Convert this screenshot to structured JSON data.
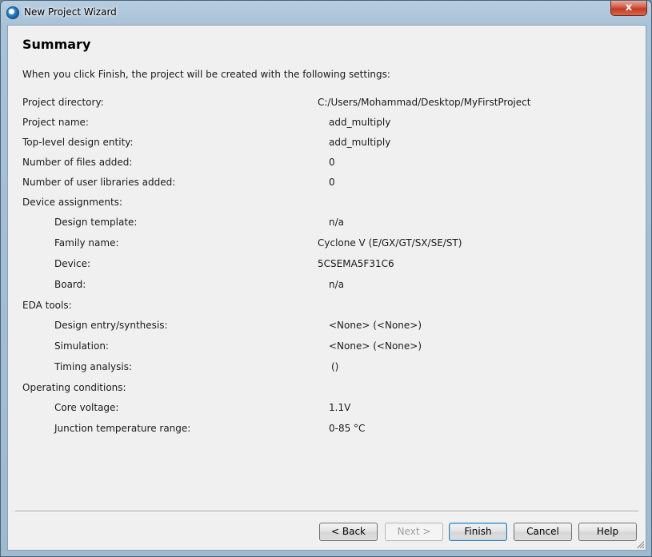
{
  "window": {
    "title": "New Project Wizard",
    "close_label": "x"
  },
  "page": {
    "heading": "Summary",
    "intro": "When you click Finish, the project will be created with the following settings:"
  },
  "settings": [
    {
      "label": "Project directory:",
      "value": "C:/Users/Mohammad/Desktop/MyFirstProject"
    },
    {
      "label": "Project name:",
      "value": "add_multiply"
    },
    {
      "label": "Top-level design entity:",
      "value": "add_multiply"
    },
    {
      "label": "Number of files added:",
      "value": "0"
    },
    {
      "label": "Number of user libraries added:",
      "value": "0"
    },
    {
      "label": "Device assignments:",
      "value": ""
    },
    {
      "label": "Design template:",
      "value": "n/a"
    },
    {
      "label": "Family name:",
      "value": "Cyclone V (E/GX/GT/SX/SE/ST)"
    },
    {
      "label": "Device:",
      "value": "5CSEMA5F31C6"
    },
    {
      "label": "Board:",
      "value": "n/a"
    },
    {
      "label": "EDA tools:",
      "value": ""
    },
    {
      "label": "Design entry/synthesis:",
      "value": "<None> (<None>)"
    },
    {
      "label": "Simulation:",
      "value": "<None> (<None>)"
    },
    {
      "label": "Timing analysis:",
      "value": "()"
    },
    {
      "label": "Operating conditions:",
      "value": ""
    },
    {
      "label": "Core voltage:",
      "value": "1.1V"
    },
    {
      "label": "Junction temperature range:",
      "value": "0-85 °C"
    }
  ],
  "buttons": {
    "back": "< Back",
    "next": "Next >",
    "finish": "Finish",
    "cancel": "Cancel",
    "help": "Help"
  }
}
